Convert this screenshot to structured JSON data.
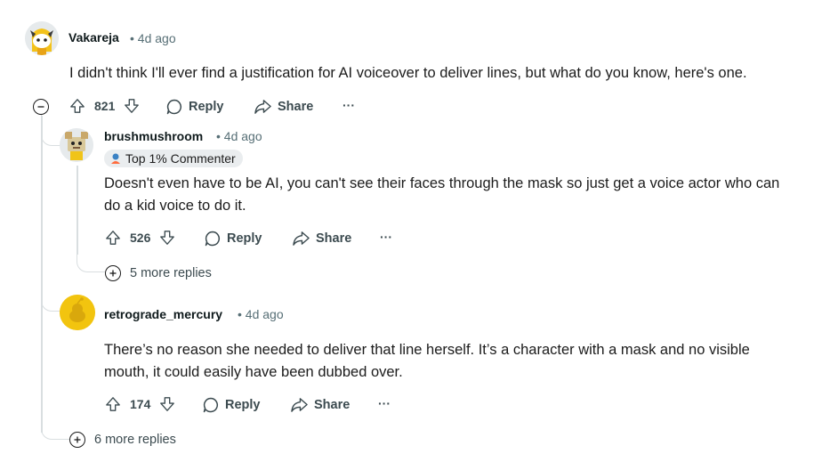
{
  "comments": [
    {
      "author": "Vakareja",
      "time": "• 4d ago",
      "text": "I didn't think I'll ever find a justification for AI voiceover to deliver lines, but what do you know, here's one.",
      "score": "821",
      "reply": "Reply",
      "share": "Share",
      "more": "···"
    },
    {
      "author": "brushmushroom",
      "time": "• 4d ago",
      "badge": "Top 1% Commenter",
      "text_lines": [
        "Doesn't even have to be AI, you can't see their faces through the mask so just get a voice actor who can",
        "do a kid voice to do it."
      ],
      "score": "526",
      "reply": "Reply",
      "share": "Share",
      "more": "···",
      "more_replies": "5 more replies"
    },
    {
      "author": "retrograde_mercury",
      "time": "• 4d ago",
      "text_lines": [
        "There’s no reason she needed to deliver that line herself. It’s a character with a mask and no visible",
        "mouth, it could easily have been dubbed over."
      ],
      "score": "174",
      "reply": "Reply",
      "share": "Share",
      "more": "···"
    }
  ],
  "top_more_replies": "6 more replies",
  "colors": {
    "snoo_yellow": "#f2c40f",
    "thread_line": "#d9dee0",
    "badge_bg": "#eaedef"
  }
}
